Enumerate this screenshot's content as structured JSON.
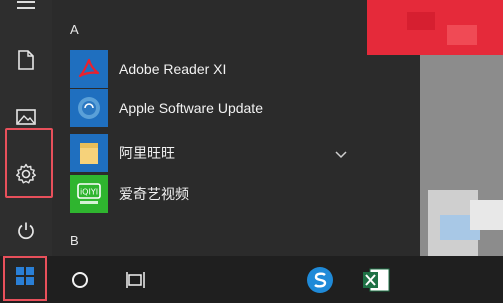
{
  "start_menu": {
    "groups": [
      {
        "letter": "A",
        "apps": [
          {
            "name": "Adobe Reader XI",
            "icon": "adobe-reader-icon",
            "color": "#1f6fbf"
          },
          {
            "name": "Apple Software Update",
            "icon": "apple-software-update-icon",
            "color": "#1f6fbf"
          },
          {
            "name": "阿里旺旺",
            "icon": "folder-icon",
            "color": "#1f6fbf",
            "expandable": true
          },
          {
            "name": "爱奇艺视频",
            "icon": "iqiyi-icon",
            "color": "#2fb52f"
          }
        ]
      },
      {
        "letter": "B",
        "apps": []
      }
    ],
    "rail": [
      "document-icon",
      "pictures-icon",
      "settings-icon",
      "power-icon"
    ]
  },
  "taskbar": {
    "items": [
      "windows-start-icon",
      "cortana-search-icon",
      "task-view-icon",
      "sogou-browser-icon",
      "excel-icon"
    ]
  },
  "colors": {
    "highlight": "#e8505b",
    "accent_blue": "#1f6fbf",
    "menu_bg": "#2b2b2b"
  }
}
